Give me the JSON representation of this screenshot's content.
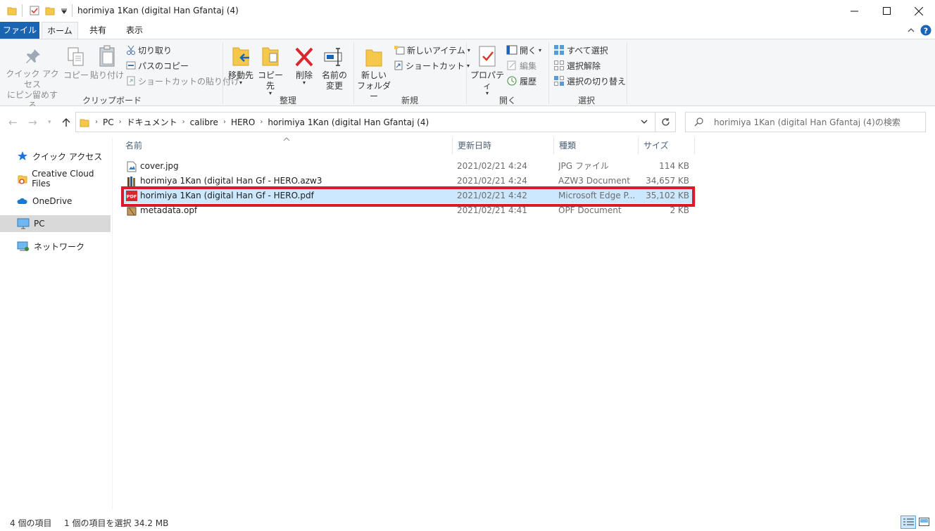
{
  "window": {
    "title": "horimiya  1Kan  (digital Han Gfantaj (4)",
    "minimize_icon": "minimize-icon",
    "maximize_icon": "maximize-icon",
    "close_icon": "close-icon"
  },
  "ribbon_tabs": {
    "file": "ファイル",
    "home": "ホーム",
    "share": "共有",
    "view": "表示"
  },
  "ribbon": {
    "clipboard": {
      "label": "クリップボード",
      "pin_line1": "クイック アクセス",
      "pin_line2": "にピン留めする",
      "copy": "コピー",
      "paste": "貼り付け",
      "cut": "切り取り",
      "copy_path": "パスのコピー",
      "paste_shortcut": "ショートカットの貼り付け"
    },
    "organize": {
      "label": "整理",
      "move_to": "移動先",
      "copy_to": "コピー先",
      "delete": "削除",
      "rename_line1": "名前の",
      "rename_line2": "変更"
    },
    "new": {
      "label": "新規",
      "new_folder_line1": "新しい",
      "new_folder_line2": "フォルダー",
      "new_item": "新しいアイテム",
      "easy_access": "ショートカット"
    },
    "open": {
      "label": "開く",
      "properties": "プロパティ",
      "open": "開く",
      "edit": "編集",
      "history": "履歴"
    },
    "select": {
      "label": "選択",
      "select_all": "すべて選択",
      "select_none": "選択解除",
      "invert": "選択の切り替え"
    }
  },
  "address": {
    "crumbs": [
      "PC",
      "ドキュメント",
      "calibre",
      "HERO",
      "horimiya  1Kan  (digital Han Gfantaj (4)"
    ],
    "search_placeholder": "horimiya  1Kan  (digital Han Gfantaj (4)の検索"
  },
  "nav_pane": {
    "items": [
      {
        "label": "クイック アクセス",
        "icon": "star-icon"
      },
      {
        "label": "Creative Cloud Files",
        "icon": "creative-cloud-icon"
      },
      {
        "label": "OneDrive",
        "icon": "cloud-icon"
      },
      {
        "label": "PC",
        "icon": "computer-icon"
      },
      {
        "label": "ネットワーク",
        "icon": "network-icon"
      }
    ]
  },
  "file_list": {
    "columns": [
      "名前",
      "更新日時",
      "種類",
      "サイズ"
    ],
    "rows": [
      {
        "name": "cover.jpg",
        "date": "2021/02/21 4:24",
        "type": "JPG ファイル",
        "size": "114 KB",
        "icon": "image-file-icon"
      },
      {
        "name": "horimiya  1Kan  (digital Han Gf - HERO.azw3",
        "date": "2021/02/21 4:24",
        "type": "AZW3 Document",
        "size": "34,657 KB",
        "icon": "books-file-icon"
      },
      {
        "name": "horimiya  1Kan  (digital Han Gf - HERO.pdf",
        "date": "2021/02/21 4:42",
        "type": "Microsoft Edge P...",
        "size": "35,102 KB",
        "icon": "pdf-file-icon"
      },
      {
        "name": "metadata.opf",
        "date": "2021/02/21 4:41",
        "type": "OPF Document",
        "size": "2 KB",
        "icon": "books-file-icon"
      }
    ]
  },
  "status": {
    "count": "4 個の項目",
    "selection": "1 個の項目を選択  34.2 MB"
  },
  "colors": {
    "accent": "#1a64b6",
    "selection": "#cce8ff",
    "highlight": "#d91b29"
  }
}
